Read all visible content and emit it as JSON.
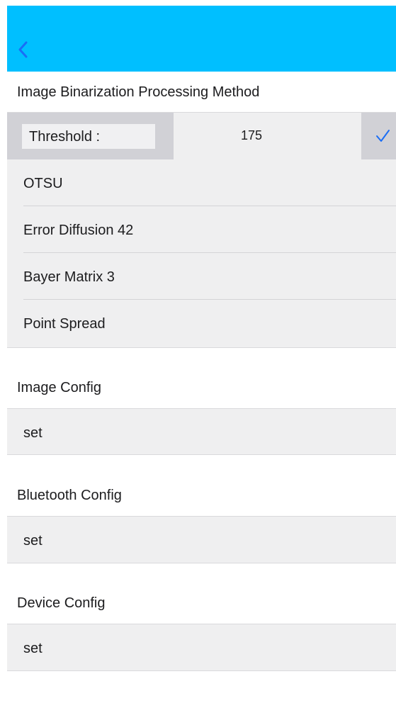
{
  "navbar": {
    "color": "#00BFFF",
    "back_icon": "chevron-left-icon"
  },
  "binarization": {
    "header": "Image Binarization Processing Method",
    "threshold": {
      "label": "Threshold :",
      "value": "175",
      "selected_icon": "checkmark-icon",
      "accent": "#007AFF"
    },
    "options": [
      {
        "label": "OTSU"
      },
      {
        "label": "Error Diffusion 42"
      },
      {
        "label": "Bayer Matrix 3"
      },
      {
        "label": "Point Spread"
      }
    ]
  },
  "image_config": {
    "header": "Image Config",
    "action": "set"
  },
  "bluetooth_config": {
    "header": "Bluetooth Config",
    "action": "set"
  },
  "device_config": {
    "header": "Device Config",
    "action": "set"
  }
}
